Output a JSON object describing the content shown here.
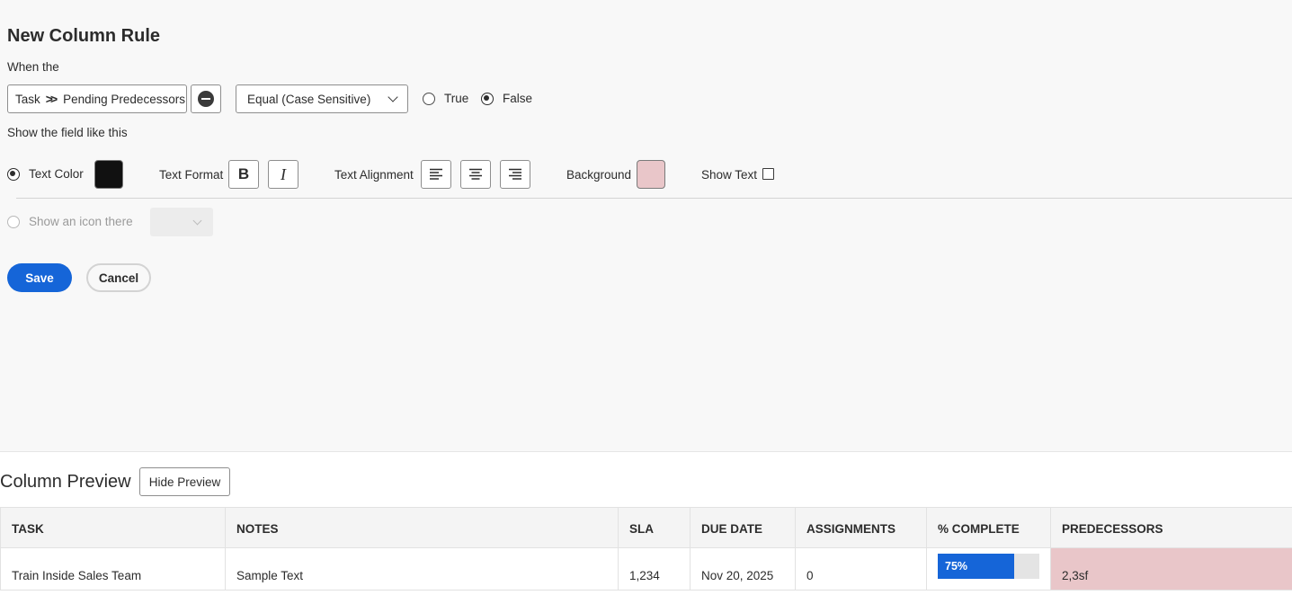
{
  "rule": {
    "title": "New Column Rule",
    "when_label": "When the",
    "field": {
      "parent": "Task",
      "child": "Pending Predecessors"
    },
    "operator": {
      "selected": "Equal (Case Sensitive)"
    },
    "value_options": [
      {
        "label": "True",
        "selected": false
      },
      {
        "label": "False",
        "selected": true
      }
    ],
    "show_label": "Show the field like this",
    "text_color": {
      "label": "Text Color",
      "selected": true,
      "color": "#111111"
    },
    "text_format": {
      "label": "Text Format",
      "bold": "B",
      "italic": "I"
    },
    "text_alignment": {
      "label": "Text Alignment"
    },
    "background": {
      "label": "Background",
      "color": "#e9c6c9"
    },
    "show_text": {
      "label": "Show Text",
      "checked": false
    },
    "icon_option": {
      "label": "Show an icon there",
      "selected": false,
      "disabled": true
    },
    "save_label": "Save",
    "cancel_label": "Cancel"
  },
  "preview": {
    "title": "Column Preview",
    "hide_label": "Hide Preview",
    "columns": [
      "TASK",
      "NOTES",
      "SLA",
      "DUE DATE",
      "ASSIGNMENTS",
      "% COMPLETE",
      "PREDECESSORS"
    ],
    "row": {
      "task": "Train Inside Sales Team",
      "notes": "Sample Text",
      "sla": "1,234",
      "due_date": "Nov 20, 2025",
      "assignments": "0",
      "percent_complete": 0.75,
      "percent_complete_label": "75%",
      "predecessors": "2,3sf"
    }
  },
  "colors": {
    "accent": "#1565d8",
    "highlight": "#e9c6c9"
  }
}
